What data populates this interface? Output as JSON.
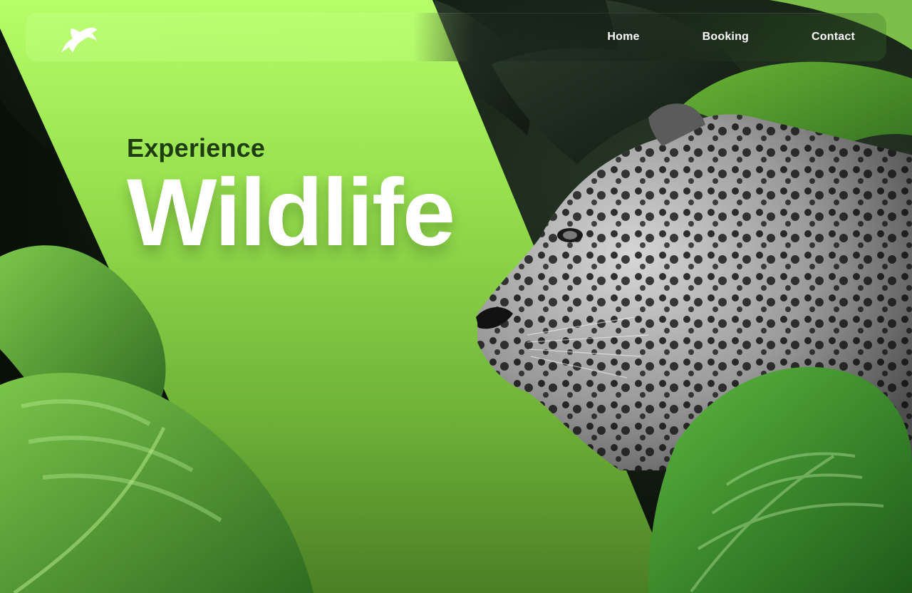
{
  "brand": {
    "logo_icon": "puma-logo-icon"
  },
  "nav": {
    "links": [
      {
        "label": "Home"
      },
      {
        "label": "Booking"
      },
      {
        "label": "Contact"
      }
    ]
  },
  "hero": {
    "kicker": "Experience",
    "title": "Wildlife"
  },
  "colors": {
    "accent_green_top": "#b6ff68",
    "accent_green_bottom": "#4b7f25",
    "text_dark_green": "#1f3c10",
    "text_white": "#ffffff"
  },
  "images": {
    "jungle_background": "jungle-foliage-image",
    "jaguar": "jaguar-portrait-image",
    "monstera_left": "monstera-leaf-left-image",
    "monstera_right": "monstera-leaf-right-image"
  }
}
